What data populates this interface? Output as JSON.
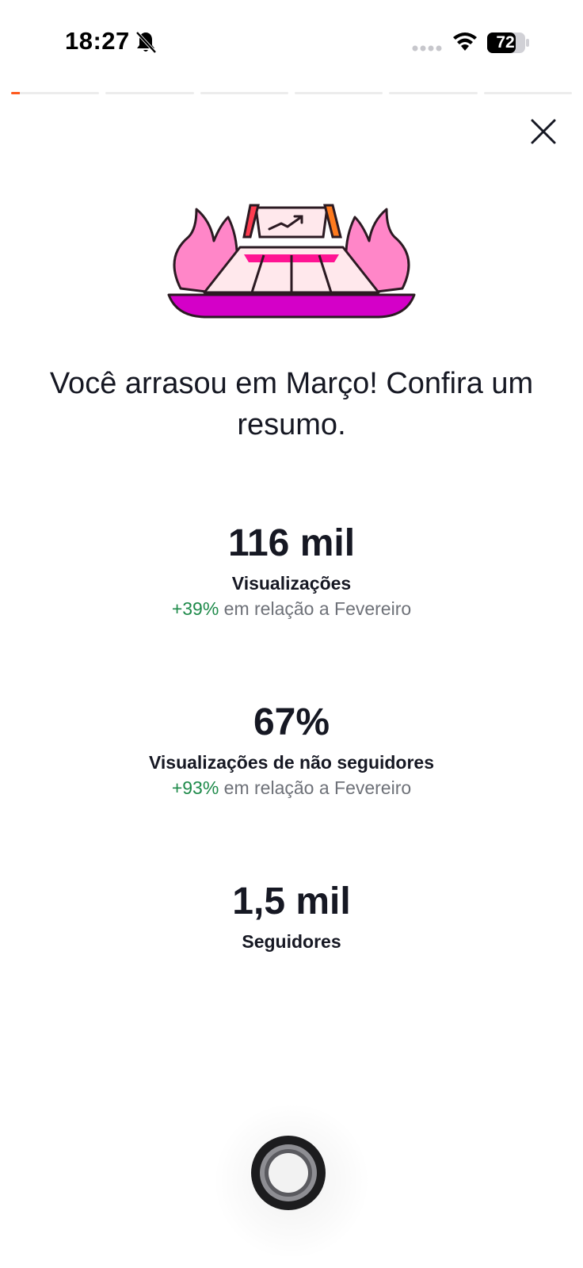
{
  "status_bar": {
    "time": "18:27",
    "battery_level": "72",
    "icons": [
      "bell-muted-icon",
      "signal-dots-icon",
      "wifi-icon",
      "battery-icon"
    ]
  },
  "stories_progress": {
    "segment_count": 6,
    "active_segment_index": 0,
    "active_segment_fill": 0.1,
    "accent_color": "#fe5a1e"
  },
  "close": {
    "icon": "close-icon"
  },
  "illustration": {
    "icon": "stadium-fire-chart-illustration"
  },
  "headline": {
    "text": "Você arrasou em Março! Confira um resumo."
  },
  "stats": [
    {
      "value": "116 mil",
      "label": "Visualizações",
      "change_pct": "+39%",
      "change_text": " em relação a Fevereiro"
    },
    {
      "value": "67%",
      "label": "Visualizações de não seguidores",
      "change_pct": "+93%",
      "change_text": " em relação a Fevereiro"
    },
    {
      "value": "1,5 mil",
      "label": "Seguidores"
    }
  ],
  "colors": {
    "positive": "#1e8a4a",
    "muted_text": "#6e7178",
    "pink_light": "#ff86c8",
    "magenta": "#d400c8",
    "orange": "#fe5a1e"
  },
  "bottom": {
    "icon": "record-circle-icon"
  }
}
